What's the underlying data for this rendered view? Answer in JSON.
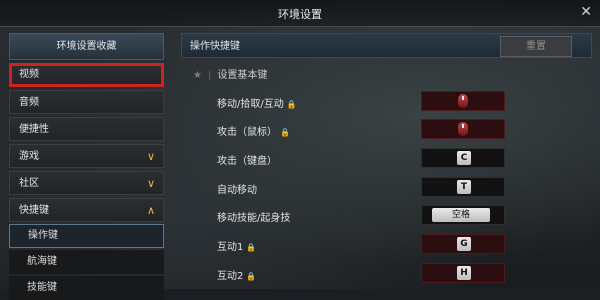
{
  "window": {
    "title": "环境设置",
    "close_icon": "close-icon"
  },
  "sidebar": {
    "header": "环境设置收藏",
    "items": [
      {
        "label": "视频",
        "selected": true
      },
      {
        "label": "音频"
      },
      {
        "label": "便捷性"
      },
      {
        "label": "游戏",
        "chevron": "∨"
      },
      {
        "label": "社区",
        "chevron": "∨"
      },
      {
        "label": "快捷键",
        "chevron": "∧"
      }
    ],
    "subitems": [
      {
        "label": "操作键",
        "active": true
      },
      {
        "label": "航海键"
      },
      {
        "label": "技能键"
      }
    ]
  },
  "main": {
    "header": "操作快捷键",
    "reset_label": "重置",
    "section_title": "设置基本键",
    "rows": [
      {
        "label": "移动/拾取/互动",
        "locked": true,
        "key": "",
        "key_type": "mouse"
      },
      {
        "label": "攻击（鼠标）",
        "locked": true,
        "key": "",
        "key_type": "mouse"
      },
      {
        "label": "攻击（键盘）",
        "locked": false,
        "key": "C",
        "key_type": "key"
      },
      {
        "label": "自动移动",
        "locked": false,
        "key": "T",
        "key_type": "key"
      },
      {
        "label": "移动技能/起身技",
        "locked": false,
        "key": "空格",
        "key_type": "wide"
      },
      {
        "label": "互动1",
        "locked": true,
        "key": "G",
        "key_type": "key"
      },
      {
        "label": "互动2",
        "locked": true,
        "key": "H",
        "key_type": "key"
      }
    ]
  },
  "colors": {
    "highlight_border": "#d22121",
    "chevron": "#e1b84b"
  }
}
